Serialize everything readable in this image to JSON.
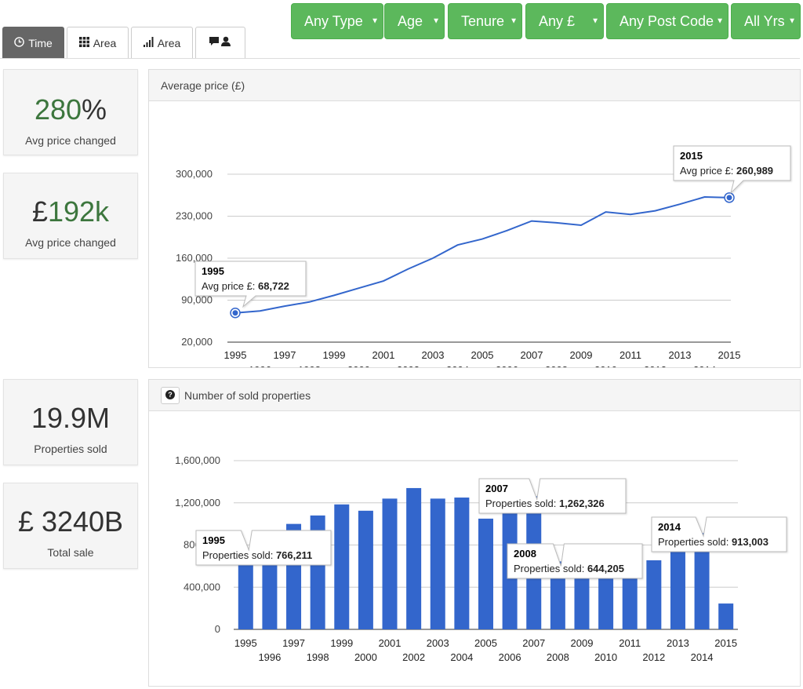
{
  "tabs": [
    {
      "label": "Time",
      "icon": "clock-icon",
      "active": true
    },
    {
      "label": "Area",
      "icon": "grid-icon"
    },
    {
      "label": "Area",
      "icon": "bar-signal-icon"
    },
    {
      "label": "",
      "icon": "comment-user-icon"
    }
  ],
  "filters": [
    "Any Type",
    "Age",
    "Tenure",
    "Any £",
    "Any Post Code",
    "All Yrs"
  ],
  "stats": [
    {
      "prefix": "",
      "value": "280",
      "suffix": "%",
      "label": "Avg price changed"
    },
    {
      "prefix": "£",
      "value": "192k",
      "suffix": "",
      "label": "Avg price changed"
    },
    {
      "prefix": "",
      "value": "19.9M",
      "suffix": "",
      "label": "Properties sold"
    },
    {
      "prefix": "",
      "value": "£ 3240B",
      "suffix": "",
      "label": "Total sale"
    }
  ],
  "colors": {
    "accent_green": "#5cb85c",
    "series_blue": "#3366cc",
    "stat_green": "#3c763d"
  },
  "chart_data": [
    {
      "type": "line",
      "title": "Average price (£)",
      "x": [
        1995,
        1996,
        1997,
        1998,
        1999,
        2000,
        2001,
        2002,
        2003,
        2004,
        2005,
        2006,
        2007,
        2008,
        2009,
        2010,
        2011,
        2012,
        2013,
        2014,
        2015
      ],
      "series": [
        {
          "values": [
            68722,
            72000,
            80000,
            87000,
            98000,
            110000,
            122000,
            142000,
            160000,
            182000,
            192000,
            206000,
            222000,
            219000,
            215000,
            237000,
            233000,
            239000,
            250000,
            262000,
            260989
          ]
        }
      ],
      "yticks": [
        "20,000",
        "90,000",
        "160,000",
        "230,000",
        "300,000"
      ],
      "ylim": [
        20000,
        300000
      ],
      "tooltips": [
        {
          "year": "1995",
          "label": "Avg price £:",
          "value": "68,722"
        },
        {
          "year": "2015",
          "label": "Avg price £:",
          "value": "260,989"
        }
      ]
    },
    {
      "type": "bar",
      "title": "Number of sold properties",
      "categories": [
        1995,
        1996,
        1997,
        1998,
        1999,
        2000,
        2001,
        2002,
        2003,
        2004,
        2005,
        2006,
        2007,
        2008,
        2009,
        2010,
        2011,
        2012,
        2013,
        2014,
        2015
      ],
      "series": [
        {
          "values": [
            766211,
            868000,
            1000000,
            1080000,
            1185000,
            1125000,
            1240000,
            1340000,
            1240000,
            1250000,
            1050000,
            1325000,
            1262326,
            644205,
            615000,
            655000,
            655000,
            655000,
            790000,
            913003,
            245000
          ]
        }
      ],
      "yticks": [
        "0",
        "400,000",
        "800,000",
        "1,200,000",
        "1,600,000"
      ],
      "ylim": [
        0,
        1600000
      ],
      "tooltips": [
        {
          "year": "1995",
          "label": "Properties sold:",
          "value": "766,211"
        },
        {
          "year": "2007",
          "label": "Properties sold:",
          "value": "1,262,326"
        },
        {
          "year": "2008",
          "label": "Properties sold:",
          "value": "644,205"
        },
        {
          "year": "2014",
          "label": "Properties sold:",
          "value": "913,003"
        }
      ]
    }
  ]
}
